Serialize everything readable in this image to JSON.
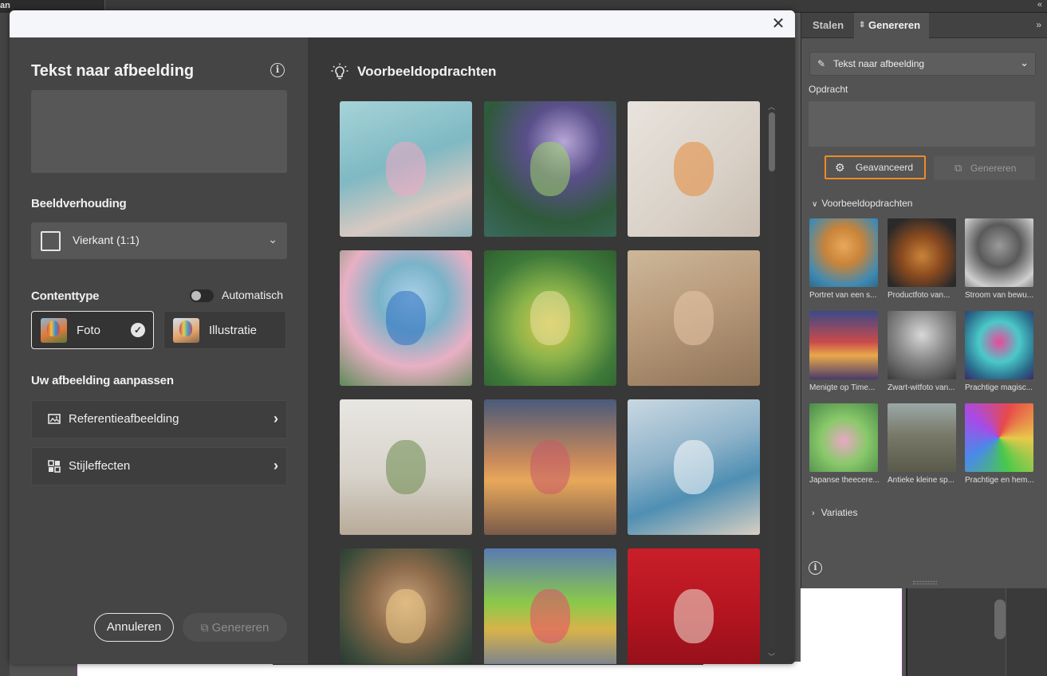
{
  "background": {
    "left_tab_text": "an",
    "collapse_glyph": "«"
  },
  "dialog": {
    "close_glyph": "✕",
    "left": {
      "title": "Tekst naar afbeelding",
      "info_glyph": "i",
      "prompt_value": "",
      "aspect_label": "Beeldverhouding",
      "aspect_value": "Vierkant (1:1)",
      "content_type_label": "Contenttype",
      "auto_toggle_label": "Automatisch",
      "auto_toggle_on": false,
      "content_types": [
        {
          "label": "Foto",
          "selected": true
        },
        {
          "label": "Illustratie",
          "selected": false
        }
      ],
      "adjust_label": "Uw afbeelding aanpassen",
      "adjust_items": [
        {
          "label": "Referentieafbeelding",
          "icon": "reference-image-icon"
        },
        {
          "label": "Stijleffecten",
          "icon": "style-effects-icon"
        }
      ],
      "cancel_label": "Annuleren",
      "generate_label": "Genereren"
    },
    "right": {
      "title": "Voorbeeldopdrachten",
      "tiles": [
        {
          "subject": "cherry-blossom-interior",
          "bg": "linear-gradient(160deg,#a6d3d8 0%,#7fb9c3 45%,#d8c9c2 75%,#8ab0b8 100%)",
          "accent": "#f2a7c4"
        },
        {
          "subject": "willow-tree-night",
          "bg": "radial-gradient(circle at 60% 30%,#b7a7d8 0%,#5a4f8a 30%,#2f5a3a 65%,#3a6a5f 100%)",
          "accent": "#9fd36a"
        },
        {
          "subject": "seashells-bottle",
          "bg": "linear-gradient(135deg,#e8e3dd 0%,#d9d1c7 60%,#c9bdb0 100%)",
          "accent": "#e58a3a"
        },
        {
          "subject": "bird-on-roses",
          "bg": "radial-gradient(circle at 55% 35%,#a9d0e8 0%,#7ab3c9 30%,#e8b0c4 60%,#5f8a5a 100%)",
          "accent": "#2f6fc2"
        },
        {
          "subject": "pears-illustration",
          "bg": "radial-gradient(circle at 50% 55%,#d9c94a 0%,#8ab34a 35%,#3f7a3a 70%,#2f5f2f 100%)",
          "accent": "#e8e0a0"
        },
        {
          "subject": "smiling-woman-sepia",
          "bg": "linear-gradient(160deg,#cdb79a 0%,#b79a7a 45%,#8f7358 100%)",
          "accent": "#e8c9a8"
        },
        {
          "subject": "living-room-cactus",
          "bg": "linear-gradient(180deg,#e8e6e2 0%,#d8d4cc 55%,#b8aa98 100%)",
          "accent": "#6a8a4a"
        },
        {
          "subject": "woman-beach-sunset",
          "bg": "linear-gradient(180deg,#4a5a7a 0%,#c98a5a 45%,#e8a85a 60%,#7a5a4a 100%)",
          "accent": "#c85a6a"
        },
        {
          "subject": "misty-beach-waves",
          "bg": "linear-gradient(160deg,#c9d8e2 0%,#8fb3c9 40%,#4f8fb3 65%,#d8cfc2 100%)",
          "accent": "#ffffff"
        },
        {
          "subject": "young-man-portrait",
          "bg": "radial-gradient(circle at 50% 40%,#c9a07a 0%,#8a6a4a 35%,#3a4a3a 70%,#1f2a2a 100%)",
          "accent": "#f2d08a"
        },
        {
          "subject": "rainy-street-painting",
          "bg": "linear-gradient(180deg,#5a7ab3 0%,#8ac94a 40%,#d8b34a 60%,#4a6ab3 100%)",
          "accent": "#e84a6a"
        },
        {
          "subject": "milkshake-red",
          "bg": "linear-gradient(180deg,#c91f2a 0%,#b3141f 50%,#8a0f19 100%)",
          "accent": "#f2e8d8"
        }
      ]
    }
  },
  "panel": {
    "tabs": [
      "Stalen",
      "Genereren"
    ],
    "active_tab": "Genereren",
    "collapse_glyph": "»",
    "mode_value": "Tekst naar afbeelding",
    "opdracht_label": "Opdracht",
    "opdracht_value": "",
    "advanced_label": "Geavanceerd",
    "generate_label": "Genereren",
    "examples_label": "Voorbeeldopdrachten",
    "examples": [
      {
        "caption": "Portret van een s...",
        "bg": "radial-gradient(circle at 50% 40%,#e8a85a 0%,#c9843a 35%,#3f8ab3 75%,#2f6a8a 100%)"
      },
      {
        "caption": "Productfoto van...",
        "bg": "radial-gradient(circle at 50% 55%,#c9843a 0%,#8a4a1f 40%,#2a2a2a 80%)"
      },
      {
        "caption": "Stroom van bewu...",
        "bg": "radial-gradient(circle at 50% 40%,#9a9a9a 0%,#5a5a5a 40%,#cfcfcf 80%,#8a8a8a 100%)"
      },
      {
        "caption": "Menigte op Time...",
        "bg": "linear-gradient(180deg,#3a4a8a 0%,#c94a4a 45%,#e8a84a 65%,#4a3a6a 100%)"
      },
      {
        "caption": "Zwart-witfoto van...",
        "bg": "radial-gradient(circle at 50% 35%,#d8d8d8 0%,#8a8a8a 45%,#3a3a3a 100%)"
      },
      {
        "caption": "Prachtige magisc...",
        "bg": "radial-gradient(circle at 50% 45%,#e84a9a 0%,#4ac9c9 40%,#2a6a8a 75%,#3a2a6a 100%)"
      },
      {
        "caption": "Japanse theecere...",
        "bg": "radial-gradient(circle at 50% 55%,#e8a8c4 0%,#8ac96a 45%,#4a8a4a 100%)"
      },
      {
        "caption": "Antieke kleine sp...",
        "bg": "linear-gradient(180deg,#9aa8a8 0%,#7a7a6a 45%,#5a5a4a 100%)"
      },
      {
        "caption": "Prachtige en hem...",
        "bg": "conic-gradient(from 20deg,#e84a4a,#e8c94a,#4ac94a,#4a8ae8,#a84ae8,#e84a4a)"
      }
    ],
    "variaties_label": "Variaties",
    "info_glyph": "i"
  }
}
